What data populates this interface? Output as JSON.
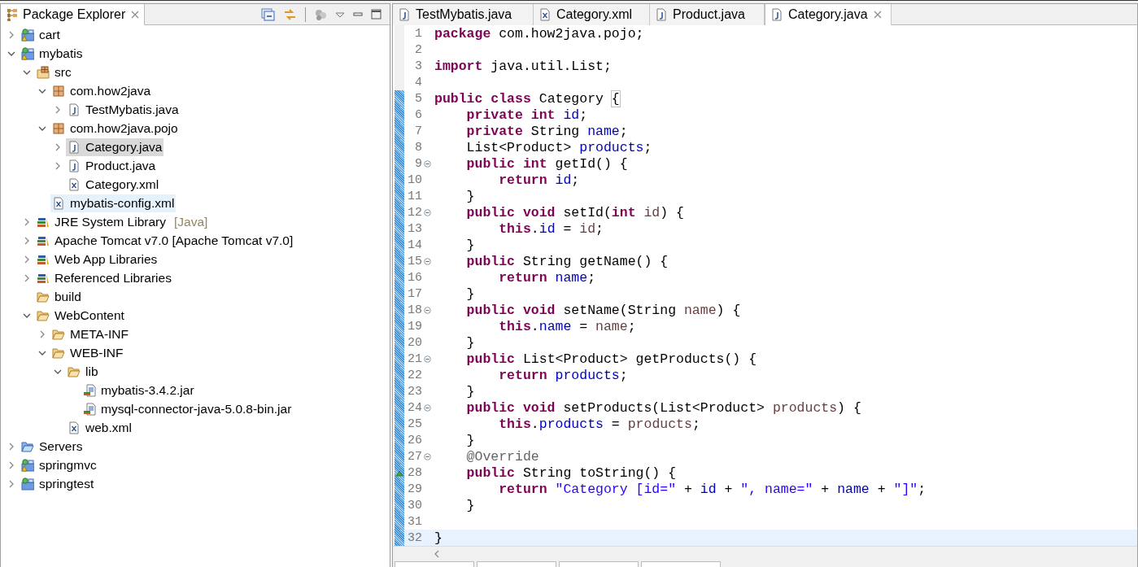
{
  "explorer": {
    "title": "Package Explorer",
    "tree": [
      {
        "label": "cart",
        "kind": "project",
        "warning": true,
        "expanded": false,
        "selected": false,
        "hovered": false
      },
      {
        "label": "mybatis",
        "kind": "project",
        "warning": true,
        "expanded": true,
        "selected": false,
        "hovered": false,
        "children": [
          {
            "label": "src",
            "kind": "srcfolder",
            "expanded": true,
            "selected": false,
            "hovered": false,
            "children": [
              {
                "label": "com.how2java",
                "kind": "package",
                "expanded": true,
                "selected": false,
                "hovered": false,
                "children": [
                  {
                    "label": "TestMybatis.java",
                    "kind": "java",
                    "expanded": false,
                    "selected": false,
                    "hovered": false
                  }
                ]
              },
              {
                "label": "com.how2java.pojo",
                "kind": "package",
                "expanded": true,
                "selected": false,
                "hovered": false,
                "children": [
                  {
                    "label": "Category.java",
                    "kind": "java",
                    "expanded": false,
                    "selected": true,
                    "hovered": false
                  },
                  {
                    "label": "Product.java",
                    "kind": "java",
                    "expanded": false,
                    "selected": false,
                    "hovered": false
                  },
                  {
                    "label": "Category.xml",
                    "kind": "xml",
                    "selected": false,
                    "hovered": false
                  }
                ]
              },
              {
                "label": "mybatis-config.xml",
                "kind": "xml",
                "selected": false,
                "hovered": true
              }
            ]
          },
          {
            "label": "JRE System Library",
            "decoration": "[Java]",
            "kind": "library",
            "expanded": false,
            "selected": false,
            "hovered": false
          },
          {
            "label": "Apache Tomcat v7.0 [Apache Tomcat v7.0]",
            "kind": "library",
            "expanded": false,
            "selected": false,
            "hovered": false
          },
          {
            "label": "Web App Libraries",
            "kind": "library",
            "expanded": false,
            "selected": false,
            "hovered": false
          },
          {
            "label": "Referenced Libraries",
            "kind": "library",
            "expanded": false,
            "selected": false,
            "hovered": false
          },
          {
            "label": "build",
            "kind": "folder",
            "selected": false,
            "hovered": false
          },
          {
            "label": "WebContent",
            "kind": "folder",
            "expanded": true,
            "selected": false,
            "hovered": false,
            "children": [
              {
                "label": "META-INF",
                "kind": "folder",
                "expanded": false,
                "selected": false,
                "hovered": false
              },
              {
                "label": "WEB-INF",
                "kind": "folder",
                "expanded": true,
                "selected": false,
                "hovered": false,
                "children": [
                  {
                    "label": "lib",
                    "kind": "folder",
                    "expanded": true,
                    "selected": false,
                    "hovered": false,
                    "children": [
                      {
                        "label": "mybatis-3.4.2.jar",
                        "kind": "jar",
                        "selected": false,
                        "hovered": false
                      },
                      {
                        "label": "mysql-connector-java-5.0.8-bin.jar",
                        "kind": "jar",
                        "selected": false,
                        "hovered": false
                      }
                    ]
                  },
                  {
                    "label": "web.xml",
                    "kind": "xml",
                    "selected": false,
                    "hovered": false
                  }
                ]
              }
            ]
          }
        ]
      },
      {
        "label": "Servers",
        "kind": "servers",
        "expanded": false,
        "selected": false,
        "hovered": false
      },
      {
        "label": "springmvc",
        "kind": "project",
        "warning": true,
        "expanded": false,
        "selected": false,
        "hovered": false
      },
      {
        "label": "springtest",
        "kind": "project",
        "warning": false,
        "expanded": false,
        "selected": false,
        "hovered": false
      }
    ]
  },
  "editor": {
    "tabs": [
      {
        "label": "TestMybatis.java",
        "kind": "java",
        "selected": false
      },
      {
        "label": "Category.xml",
        "kind": "xml",
        "selected": false
      },
      {
        "label": "Product.java",
        "kind": "java",
        "selected": false
      },
      {
        "label": "Category.java",
        "kind": "java",
        "selected": true
      }
    ],
    "lines": [
      {
        "number": "1",
        "changed": false,
        "fold": false,
        "override": false,
        "current": false,
        "tokens": [
          {
            "kind": "kw",
            "text": "package"
          },
          {
            "kind": "plain",
            "text": " com.how2java.pojo;"
          }
        ]
      },
      {
        "number": "2",
        "changed": false,
        "fold": false,
        "override": false,
        "current": false
      },
      {
        "number": "3",
        "changed": false,
        "fold": false,
        "override": false,
        "current": false,
        "tokens": [
          {
            "kind": "kw",
            "text": "import"
          },
          {
            "kind": "plain",
            "text": " java.util.List;"
          }
        ]
      },
      {
        "number": "4",
        "changed": false,
        "fold": false,
        "override": false,
        "current": false
      },
      {
        "number": "5",
        "changed": true,
        "fold": false,
        "override": false,
        "current": false,
        "tokens": [
          {
            "kind": "kw",
            "text": "public class"
          },
          {
            "kind": "plain",
            "text": " Category "
          },
          {
            "kind": "match",
            "text": "{"
          }
        ]
      },
      {
        "number": "6",
        "changed": true,
        "fold": false,
        "override": false,
        "current": false,
        "tokens": [
          {
            "kind": "kw",
            "text": "    private int"
          },
          {
            "kind": "field",
            "text": " id"
          },
          {
            "kind": "plain",
            "text": ";"
          }
        ]
      },
      {
        "number": "7",
        "changed": true,
        "fold": false,
        "override": false,
        "current": false,
        "tokens": [
          {
            "kind": "kw",
            "text": "    private"
          },
          {
            "kind": "plain",
            "text": " String "
          },
          {
            "kind": "field",
            "text": "name"
          },
          {
            "kind": "plain",
            "text": ";"
          }
        ]
      },
      {
        "number": "8",
        "changed": true,
        "fold": false,
        "override": false,
        "current": false,
        "tokens": [
          {
            "kind": "plain",
            "text": "    List<Product> "
          },
          {
            "kind": "field",
            "text": "products"
          },
          {
            "kind": "plain",
            "text": ";"
          }
        ]
      },
      {
        "number": "9",
        "changed": true,
        "fold": true,
        "override": false,
        "current": false,
        "tokens": [
          {
            "kind": "kw",
            "text": "    public int"
          },
          {
            "kind": "plain",
            "text": " getId() {"
          }
        ]
      },
      {
        "number": "10",
        "changed": true,
        "fold": false,
        "override": false,
        "current": false,
        "tokens": [
          {
            "kind": "kw",
            "text": "        return"
          },
          {
            "kind": "field",
            "text": " id"
          },
          {
            "kind": "plain",
            "text": ";"
          }
        ]
      },
      {
        "number": "11",
        "changed": true,
        "fold": false,
        "override": false,
        "current": false,
        "tokens": [
          {
            "kind": "plain",
            "text": "    }"
          }
        ]
      },
      {
        "number": "12",
        "changed": true,
        "fold": true,
        "override": false,
        "current": false,
        "tokens": [
          {
            "kind": "kw",
            "text": "    public void"
          },
          {
            "kind": "plain",
            "text": " setId("
          },
          {
            "kind": "kw",
            "text": "int"
          },
          {
            "kind": "local",
            "text": " id"
          },
          {
            "kind": "plain",
            "text": ") {"
          }
        ]
      },
      {
        "number": "13",
        "changed": true,
        "fold": false,
        "override": false,
        "current": false,
        "tokens": [
          {
            "kind": "kw",
            "text": "        this"
          },
          {
            "kind": "plain",
            "text": "."
          },
          {
            "kind": "field",
            "text": "id"
          },
          {
            "kind": "plain",
            "text": " = "
          },
          {
            "kind": "local",
            "text": "id"
          },
          {
            "kind": "plain",
            "text": ";"
          }
        ]
      },
      {
        "number": "14",
        "changed": true,
        "fold": false,
        "override": false,
        "current": false,
        "tokens": [
          {
            "kind": "plain",
            "text": "    }"
          }
        ]
      },
      {
        "number": "15",
        "changed": true,
        "fold": true,
        "override": false,
        "current": false,
        "tokens": [
          {
            "kind": "kw",
            "text": "    public"
          },
          {
            "kind": "plain",
            "text": " String getName() {"
          }
        ]
      },
      {
        "number": "16",
        "changed": true,
        "fold": false,
        "override": false,
        "current": false,
        "tokens": [
          {
            "kind": "kw",
            "text": "        return"
          },
          {
            "kind": "field",
            "text": " name"
          },
          {
            "kind": "plain",
            "text": ";"
          }
        ]
      },
      {
        "number": "17",
        "changed": true,
        "fold": false,
        "override": false,
        "current": false,
        "tokens": [
          {
            "kind": "plain",
            "text": "    }"
          }
        ]
      },
      {
        "number": "18",
        "changed": true,
        "fold": true,
        "override": false,
        "current": false,
        "tokens": [
          {
            "kind": "kw",
            "text": "    public void"
          },
          {
            "kind": "plain",
            "text": " setName(String "
          },
          {
            "kind": "local",
            "text": "name"
          },
          {
            "kind": "plain",
            "text": ") {"
          }
        ]
      },
      {
        "number": "19",
        "changed": true,
        "fold": false,
        "override": false,
        "current": false,
        "tokens": [
          {
            "kind": "kw",
            "text": "        this"
          },
          {
            "kind": "plain",
            "text": "."
          },
          {
            "kind": "field",
            "text": "name"
          },
          {
            "kind": "plain",
            "text": " = "
          },
          {
            "kind": "local",
            "text": "name"
          },
          {
            "kind": "plain",
            "text": ";"
          }
        ]
      },
      {
        "number": "20",
        "changed": true,
        "fold": false,
        "override": false,
        "current": false,
        "tokens": [
          {
            "kind": "plain",
            "text": "    }"
          }
        ]
      },
      {
        "number": "21",
        "changed": true,
        "fold": true,
        "override": false,
        "current": false,
        "tokens": [
          {
            "kind": "kw",
            "text": "    public"
          },
          {
            "kind": "plain",
            "text": " List<Product> getProducts() {"
          }
        ]
      },
      {
        "number": "22",
        "changed": true,
        "fold": false,
        "override": false,
        "current": false,
        "tokens": [
          {
            "kind": "kw",
            "text": "        return"
          },
          {
            "kind": "field",
            "text": " products"
          },
          {
            "kind": "plain",
            "text": ";"
          }
        ]
      },
      {
        "number": "23",
        "changed": true,
        "fold": false,
        "override": false,
        "current": false,
        "tokens": [
          {
            "kind": "plain",
            "text": "    }"
          }
        ]
      },
      {
        "number": "24",
        "changed": true,
        "fold": true,
        "override": false,
        "current": false,
        "tokens": [
          {
            "kind": "kw",
            "text": "    public void"
          },
          {
            "kind": "plain",
            "text": " setProducts(List<Product> "
          },
          {
            "kind": "local",
            "text": "products"
          },
          {
            "kind": "plain",
            "text": ") {"
          }
        ]
      },
      {
        "number": "25",
        "changed": true,
        "fold": false,
        "override": false,
        "current": false,
        "tokens": [
          {
            "kind": "kw",
            "text": "        this"
          },
          {
            "kind": "plain",
            "text": "."
          },
          {
            "kind": "field",
            "text": "products"
          },
          {
            "kind": "plain",
            "text": " = "
          },
          {
            "kind": "local",
            "text": "products"
          },
          {
            "kind": "plain",
            "text": ";"
          }
        ]
      },
      {
        "number": "26",
        "changed": true,
        "fold": false,
        "override": false,
        "current": false,
        "tokens": [
          {
            "kind": "plain",
            "text": "    }"
          }
        ]
      },
      {
        "number": "27",
        "changed": true,
        "fold": true,
        "override": false,
        "current": false,
        "tokens": [
          {
            "kind": "ann",
            "text": "    @Override"
          }
        ]
      },
      {
        "number": "28",
        "changed": true,
        "fold": false,
        "override": true,
        "current": false,
        "tokens": [
          {
            "kind": "kw",
            "text": "    public"
          },
          {
            "kind": "plain",
            "text": " String toString() {"
          }
        ]
      },
      {
        "number": "29",
        "changed": true,
        "fold": false,
        "override": false,
        "current": false,
        "tokens": [
          {
            "kind": "kw",
            "text": "        return"
          },
          {
            "kind": "str",
            "text": " \"Category [id=\""
          },
          {
            "kind": "plain",
            "text": " + "
          },
          {
            "kind": "field",
            "text": "id"
          },
          {
            "kind": "plain",
            "text": " + "
          },
          {
            "kind": "str",
            "text": "\", name=\""
          },
          {
            "kind": "plain",
            "text": " + "
          },
          {
            "kind": "field",
            "text": "name"
          },
          {
            "kind": "plain",
            "text": " + "
          },
          {
            "kind": "str",
            "text": "\"]\""
          },
          {
            "kind": "plain",
            "text": ";"
          }
        ]
      },
      {
        "number": "30",
        "changed": true,
        "fold": false,
        "override": false,
        "current": false,
        "tokens": [
          {
            "kind": "plain",
            "text": "    }"
          }
        ]
      },
      {
        "number": "31",
        "changed": true,
        "fold": false,
        "override": false,
        "current": false
      },
      {
        "number": "32",
        "changed": true,
        "fold": false,
        "override": false,
        "current": true,
        "tokens": [
          {
            "kind": "plain",
            "text": "}"
          }
        ]
      }
    ]
  }
}
